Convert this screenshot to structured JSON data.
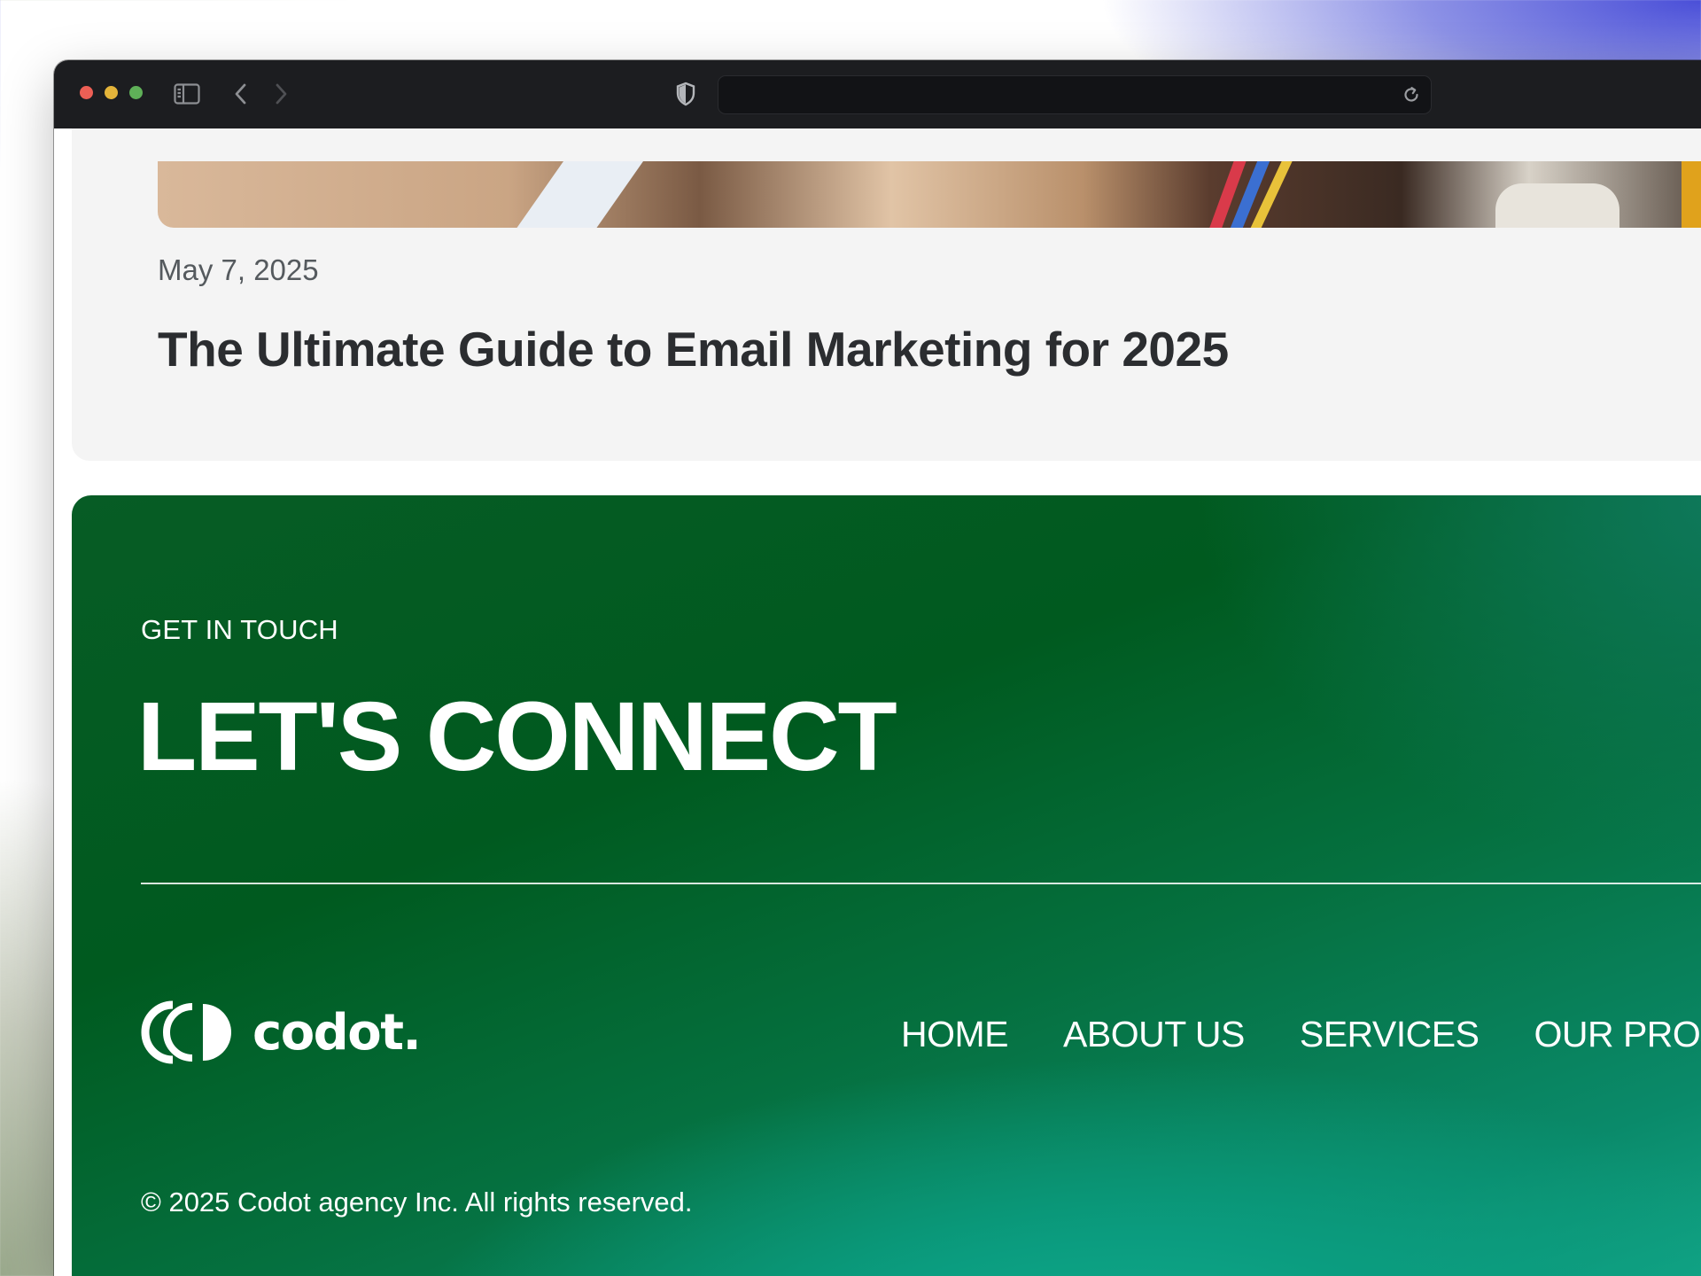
{
  "browser": {
    "window_controls": [
      "close",
      "minimize",
      "zoom"
    ],
    "toolbar_icons": [
      "sidebar-icon",
      "back-arrow-icon",
      "forward-arrow-icon",
      "shield-icon",
      "reload-icon"
    ],
    "address_bar": {
      "value": ""
    }
  },
  "blog_card": {
    "date": "May 7, 2025",
    "title": "The Ultimate Guide to Email Marketing for 2025"
  },
  "footer": {
    "eyebrow": "GET IN TOUCH",
    "headline": "LET'S CONNECT",
    "logo_text": "codot.",
    "nav": [
      "HOME",
      "ABOUT US",
      "SERVICES",
      "OUR PROJ"
    ],
    "copyright": "© 2025 Codot agency Inc. All rights reserved.",
    "colors": {
      "footer_green": "#005a1f",
      "footer_teal": "#13a88a",
      "text": "#ffffff"
    }
  },
  "colors": {
    "toolbar": "#1c1d20",
    "card_bg": "#f4f4f4",
    "date_text": "#555a5e",
    "title_text": "#2b2d30"
  }
}
